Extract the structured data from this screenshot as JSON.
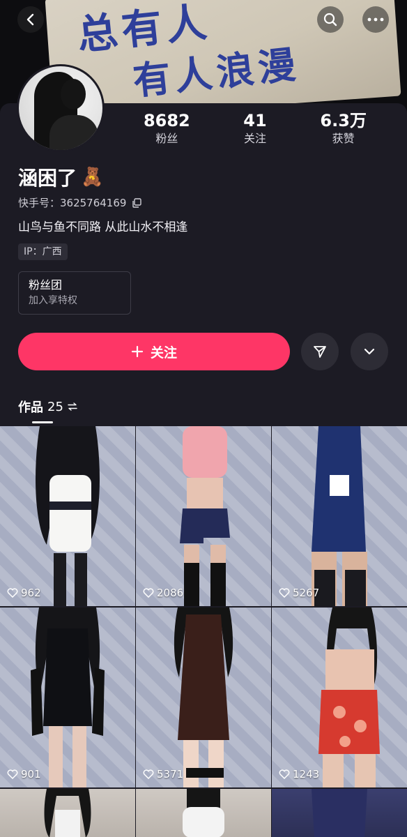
{
  "cover": {
    "ink_line1": "总有人",
    "ink_line2": "有人浪漫"
  },
  "nav": {
    "back_icon": "chevron-left-icon",
    "search_icon": "search-icon",
    "more_icon": "more-dots-icon"
  },
  "stats": [
    {
      "value": "8682",
      "label": "粉丝"
    },
    {
      "value": "41",
      "label": "关注"
    },
    {
      "value": "6.3万",
      "label": "获赞"
    }
  ],
  "profile": {
    "nickname": "涵困了",
    "nickname_emoji": "🧸",
    "kuaishou_id_label": "快手号：3625764169",
    "bio": "山鸟与鱼不同路 从此山水不相逢",
    "ip": "IP：广西"
  },
  "fan_club": {
    "title": "粉丝团",
    "subtitle": "加入享特权"
  },
  "actions": {
    "follow_label": "关注",
    "follow_icon": "plus-icon",
    "share_icon": "share-send-icon",
    "expand_icon": "chevron-down-icon"
  },
  "works_tab": {
    "label": "作品",
    "count": "25",
    "switch_icon": "switch-arrows-icon"
  },
  "colors": {
    "follow_button": "#fe3666",
    "background": "#1c1b24",
    "chip": "#2e2d37"
  },
  "grid": [
    {
      "likes": "962"
    },
    {
      "likes": "2086"
    },
    {
      "likes": "5267"
    },
    {
      "likes": "901"
    },
    {
      "likes": "5371"
    },
    {
      "likes": "1243"
    }
  ]
}
